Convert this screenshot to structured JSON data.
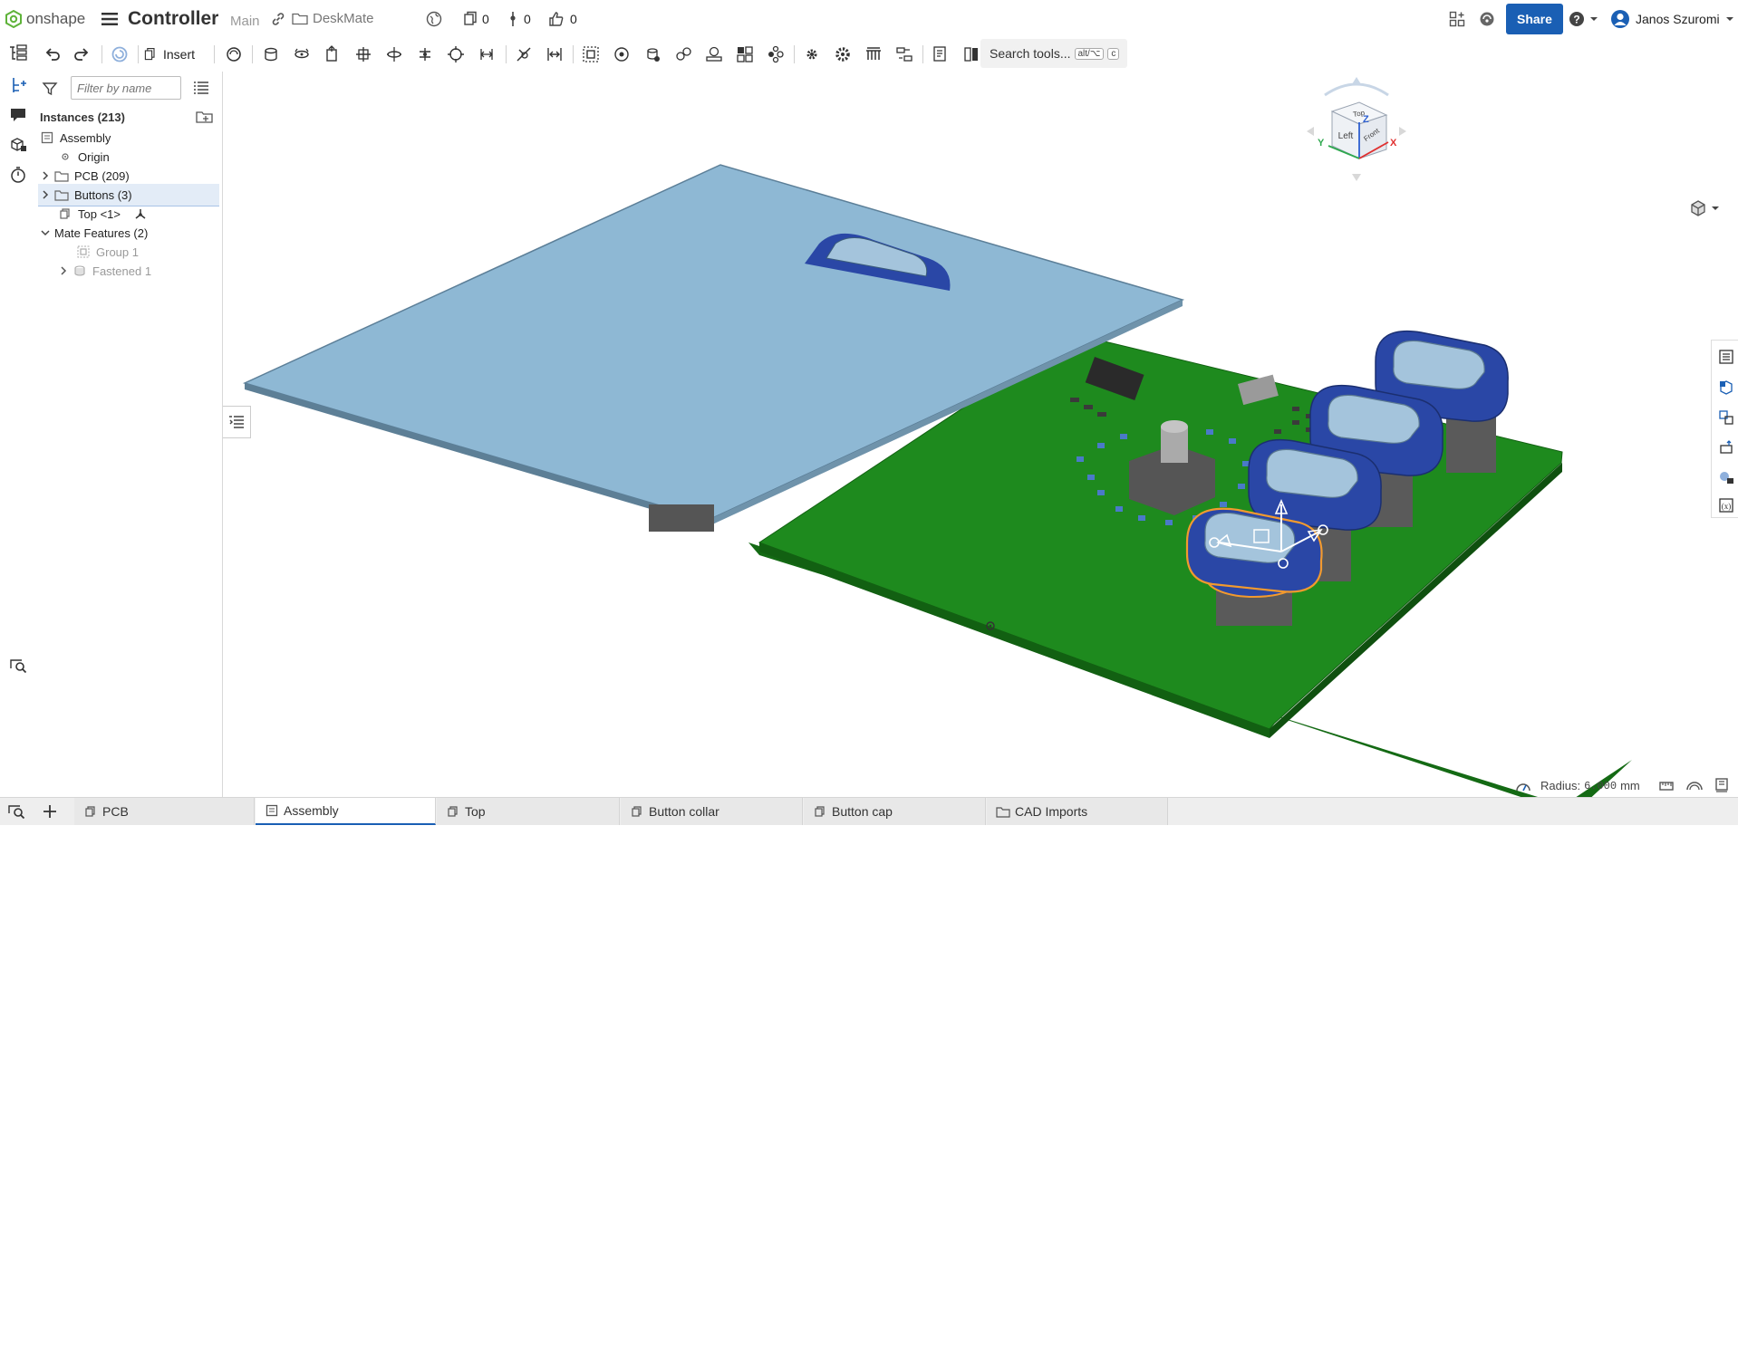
{
  "app": {
    "brand": "onshape",
    "doc_title": "Controller",
    "branch": "Main",
    "folder": "DeskMate",
    "counts": {
      "versions": "0",
      "branches": "0",
      "likes": "0"
    },
    "share_label": "Share",
    "user_name": "Janos Szuromi",
    "accent": "#1a5fb4"
  },
  "toolbar": {
    "insert_label": "Insert",
    "search_label": "Search tools...",
    "search_shortcut_1": "alt/⌥",
    "search_shortcut_2": "c"
  },
  "panel": {
    "filter_placeholder": "Filter by name",
    "instances_label": "Instances (213)",
    "tree": {
      "assembly": "Assembly",
      "origin": "Origin",
      "pcb": "PCB (209)",
      "buttons": "Buttons (3)",
      "top": "Top <1>",
      "mate_features": "Mate Features (2)",
      "group": "Group 1",
      "fastened": "Fastened 1"
    }
  },
  "viewport": {
    "radius_label": "Radius:",
    "radius_value": "6.000",
    "radius_unit": "mm",
    "viewcube": {
      "top": "Top",
      "left": "Left",
      "front": "Front",
      "axis_x": "X",
      "axis_y": "Y",
      "axis_z": "Z"
    }
  },
  "tabs": {
    "pcb": "PCB",
    "assembly": "Assembly",
    "top": "Top",
    "button_collar": "Button collar",
    "button_cap": "Button cap",
    "cad_imports": "CAD Imports"
  },
  "colors": {
    "pcb_green": "#1e8a1e",
    "display_blue": "#8eb8d4",
    "button_blue": "#2a47a6",
    "selection_orange": "#f29a2e"
  }
}
